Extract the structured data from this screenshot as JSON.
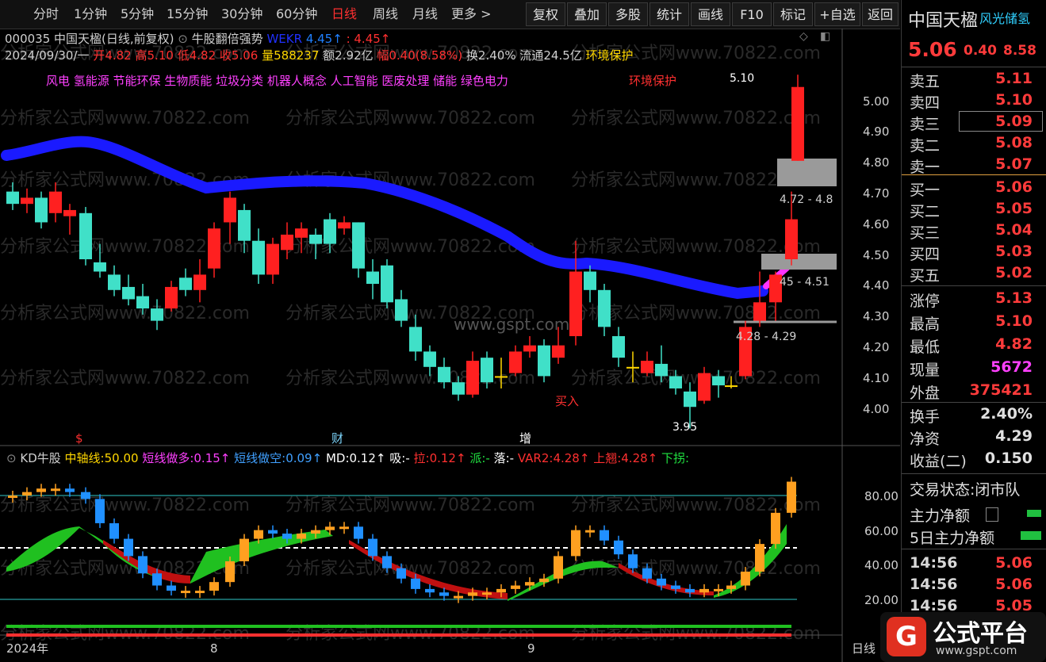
{
  "toolbar": {
    "periods": [
      "分时",
      "1分钟",
      "5分钟",
      "15分钟",
      "30分钟",
      "60分钟",
      "日线",
      "周线",
      "月线",
      "更多 >"
    ],
    "active_index": 6,
    "buttons": [
      "复权",
      "叠加",
      "多股",
      "统计",
      "画线",
      "F10",
      "标记",
      "+自选",
      "返回"
    ]
  },
  "header": {
    "stock": "000035 中国天楹(日线,前复权)",
    "indicator": "牛股翻倍强势",
    "wekr_label": "WEKR",
    "wekr_value": "4.45↑",
    "wekr_value2": ": 4.45↑",
    "date": "2024/09/30/一",
    "open_label": "开",
    "open": "4.82",
    "high_label": "高",
    "high": "5.10",
    "low_label": "低",
    "low": "4.82",
    "close_label": "收",
    "close": "5.06",
    "vol_label": "量",
    "vol": "588237",
    "amount": "额2.92亿",
    "change_label": "幅",
    "change": "0.40(8.58%)",
    "turnover": "换2.40%",
    "float": "流通24.5亿",
    "theme": "环境保护",
    "concepts": "风电 氢能源 节能环保 生物质能 垃圾分类 机器人概念 人工智能 医废处理 储能 绿色电力",
    "concept_red": "环境保护"
  },
  "main_annotations": {
    "peak": "5.10",
    "zone1": "4.72 - 4.8",
    "zone2": "45 - 4.51",
    "zone3": "4.28 - 4.29",
    "low": "3.95",
    "buy": "买入",
    "marker_s": "$",
    "marker_cai": "财",
    "marker_zeng": "增"
  },
  "price_axis": [
    "5.00",
    "4.90",
    "4.80",
    "4.70",
    "4.60",
    "4.50",
    "4.40",
    "4.30",
    "4.20",
    "4.10",
    "4.00"
  ],
  "watermarks": [
    "分析家公式网www.70822.com",
    "www.gspt.com"
  ],
  "sub_header": {
    "name": "KD牛股",
    "mid_label": "中轴线:",
    "mid_val": "50.00",
    "short_long_label": "短线做多:",
    "short_long_val": "0.15↑",
    "short_short_label": "短线做空:",
    "short_short_val": "0.09↑",
    "md_label": "MD:",
    "md_val": "0.12↑",
    "xi_label": "吸:",
    "xi_val": "-",
    "la_label": "拉:",
    "la_val": "0.12↑",
    "pai_label": "派:",
    "pai_val": "-",
    "luo_label": "落:",
    "luo_val": "-",
    "var2_label": "VAR2:",
    "var2_val": "4.28↑",
    "shangqiao_label": "上翘:",
    "shangqiao_val": "4.28↑",
    "xiaguai_label": "下拐:"
  },
  "sub_axis": [
    "80.00",
    "60.00",
    "40.00",
    "20.00"
  ],
  "x_axis": [
    "2024年",
    "8",
    "9"
  ],
  "x_axis_right": "日线",
  "side": {
    "name": "中国天楹",
    "name2": "风光储氢",
    "price": "5.06",
    "change": "0.40",
    "pct": "8.58",
    "asks": [
      [
        "卖五",
        "5.11"
      ],
      [
        "卖四",
        "5.10"
      ],
      [
        "卖三",
        "5.09"
      ],
      [
        "卖二",
        "5.08"
      ],
      [
        "卖一",
        "5.07"
      ]
    ],
    "bids": [
      [
        "买一",
        "5.06"
      ],
      [
        "买二",
        "5.05"
      ],
      [
        "买三",
        "5.04"
      ],
      [
        "买四",
        "5.03"
      ],
      [
        "买五",
        "5.02"
      ]
    ],
    "stats": [
      [
        "涨停",
        "5.13"
      ],
      [
        "最高",
        "5.10"
      ],
      [
        "最低",
        "4.82"
      ],
      [
        "现量",
        "5672"
      ],
      [
        "外盘",
        "375421"
      ]
    ],
    "stats2": [
      [
        "换手",
        "2.40%"
      ],
      [
        "净资",
        "4.29"
      ],
      [
        "收益(二)",
        "0.150"
      ]
    ],
    "trade_status": "交易状态:闭市队",
    "net1": "主力净额",
    "net5": "5日主力净额",
    "ticks": [
      [
        "14:56",
        "5.06"
      ],
      [
        "14:56",
        "5.06"
      ],
      [
        "14:56",
        "5.05"
      ]
    ]
  },
  "logo": {
    "text": "公式平台",
    "url": "www.gspt.com",
    "glyph": "G"
  },
  "colors": {
    "up": "#ff2020",
    "down": "#40e0c8",
    "ma": "#1a1aff",
    "ema_up": "#20c020",
    "ema_down": "#c01010"
  }
}
